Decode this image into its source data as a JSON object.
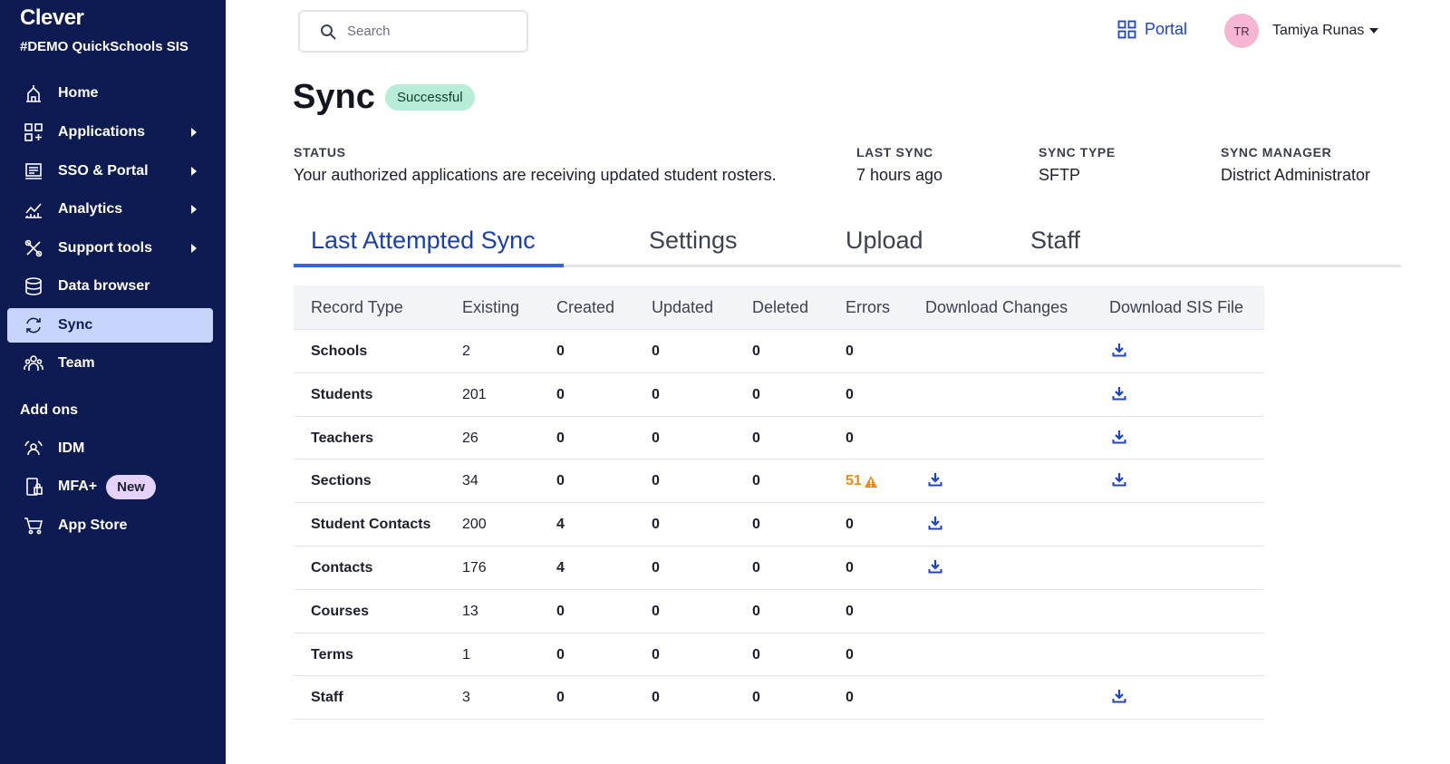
{
  "sidebar": {
    "brand": "Clever",
    "district": "#DEMO QuickSchools SIS",
    "items": [
      {
        "label": "Home",
        "icon": "home-icon"
      },
      {
        "label": "Applications",
        "icon": "apps-icon"
      },
      {
        "label": "SSO & Portal",
        "icon": "sso-portal-icon"
      },
      {
        "label": "Analytics",
        "icon": "analytics-icon"
      },
      {
        "label": "Support tools",
        "icon": "support-tools-icon"
      },
      {
        "label": "Data browser",
        "icon": "database-icon"
      },
      {
        "label": "Sync",
        "icon": "sync-icon"
      },
      {
        "label": "Team",
        "icon": "team-icon"
      }
    ],
    "addons_label": "Add ons",
    "addons": [
      {
        "label": "IDM",
        "icon": "idm-icon"
      },
      {
        "label": "MFA+",
        "icon": "mfa-icon",
        "badge": "New"
      },
      {
        "label": "App Store",
        "icon": "cart-icon"
      }
    ]
  },
  "topbar": {
    "search_placeholder": "Search",
    "portal_label": "Portal",
    "avatar_initials": "TR",
    "user_name": "Tamiya Runas"
  },
  "header": {
    "title": "Sync",
    "status_badge": "Successful"
  },
  "meta": {
    "status_label": "STATUS",
    "status_value": "Your authorized applications are receiving updated student rosters.",
    "last_sync_label": "LAST SYNC",
    "last_sync_value": "7 hours ago",
    "sync_type_label": "SYNC TYPE",
    "sync_type_value": "SFTP",
    "sync_manager_label": "SYNC MANAGER",
    "sync_manager_value": "District Administrator"
  },
  "tabs": [
    "Last Attempted Sync",
    "Settings",
    "Upload",
    "Staff"
  ],
  "table": {
    "headers": [
      "Record Type",
      "Existing",
      "Created",
      "Updated",
      "Deleted",
      "Errors",
      "Download Changes",
      "Download SIS File"
    ],
    "rows": [
      {
        "type": "Schools",
        "existing": "2",
        "created": "0",
        "updated": "0",
        "deleted": "0",
        "errors": "0",
        "changes": false,
        "sis": true
      },
      {
        "type": "Students",
        "existing": "201",
        "created": "0",
        "updated": "0",
        "deleted": "0",
        "errors": "0",
        "changes": false,
        "sis": true
      },
      {
        "type": "Teachers",
        "existing": "26",
        "created": "0",
        "updated": "0",
        "deleted": "0",
        "errors": "0",
        "changes": false,
        "sis": true
      },
      {
        "type": "Sections",
        "existing": "34",
        "created": "0",
        "updated": "0",
        "deleted": "0",
        "errors": "51",
        "warning": true,
        "changes": true,
        "sis": true
      },
      {
        "type": "Student Contacts",
        "existing": "200",
        "created": "4",
        "updated": "0",
        "deleted": "0",
        "errors": "0",
        "changes": true,
        "sis": false
      },
      {
        "type": "Contacts",
        "existing": "176",
        "created": "4",
        "updated": "0",
        "deleted": "0",
        "errors": "0",
        "changes": true,
        "sis": false
      },
      {
        "type": "Courses",
        "existing": "13",
        "created": "0",
        "updated": "0",
        "deleted": "0",
        "errors": "0",
        "changes": false,
        "sis": false
      },
      {
        "type": "Terms",
        "existing": "1",
        "created": "0",
        "updated": "0",
        "deleted": "0",
        "errors": "0",
        "changes": false,
        "sis": false
      },
      {
        "type": "Staff",
        "existing": "3",
        "created": "0",
        "updated": "0",
        "deleted": "0",
        "errors": "0",
        "changes": false,
        "sis": true
      }
    ]
  },
  "colors": {
    "sidebar_bg": "#0d1b52",
    "active_nav": "#c8d4fb",
    "accent": "#1b44c8",
    "success_badge": "#b7ecd6",
    "warning": "#ee8a12",
    "new_badge": "#e4d2fb"
  }
}
